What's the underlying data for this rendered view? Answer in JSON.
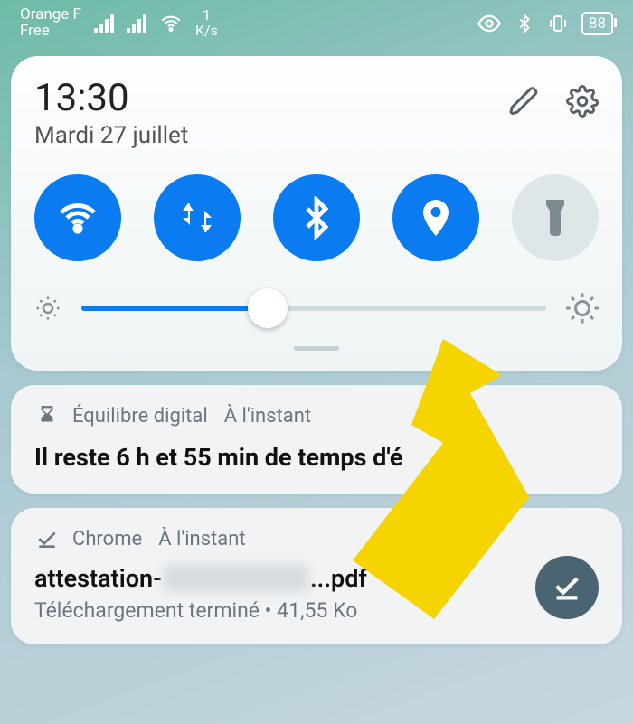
{
  "status_bar": {
    "carrier1": "Orange F",
    "carrier2": "Free",
    "speed_value": "1",
    "speed_unit": "K/s",
    "battery_pct": "88"
  },
  "quick_settings": {
    "time": "13:30",
    "date": "Mardi 27 juillet",
    "toggles": {
      "wifi": "wifi",
      "data": "data",
      "bluetooth": "bluetooth",
      "location": "location",
      "flashlight": "flashlight"
    }
  },
  "notification_wellbeing": {
    "app": "Équilibre digital",
    "time": "À l'instant",
    "title": "Il reste 6 h et 55 min de temps d'é"
  },
  "notification_download": {
    "app": "Chrome",
    "time": "À l'instant",
    "file_prefix": "attestation-",
    "file_suffix": "...pdf",
    "status": "Téléchargement terminé • 41,55 Ko"
  }
}
